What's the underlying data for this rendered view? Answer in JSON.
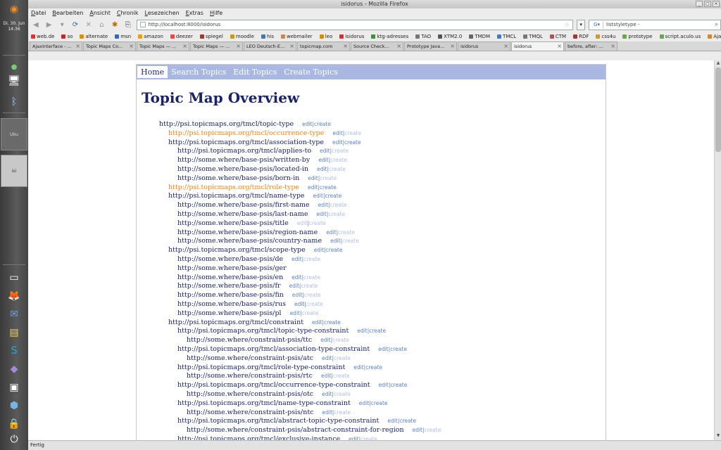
{
  "window": {
    "title": "isidorus - Mozilla Firefox"
  },
  "dock": {
    "clock": "Di, 30. Jun\n14:36",
    "task1": "Ubu",
    "task2": "isi"
  },
  "menubar": [
    "Datei",
    "Bearbeiten",
    "Ansicht",
    "Chronik",
    "Lesezeichen",
    "Extras",
    "Hilfe"
  ],
  "navbar": {
    "url": "http://localhost:8000/isidorus",
    "search_value": "liststyletype -",
    "search_engine_icon": "google-icon"
  },
  "bookmarks": [
    "web.de",
    "so",
    "alternate",
    "msn",
    "amazon",
    "deezer",
    "spiegel",
    "moodle",
    "his",
    "webmailer",
    "leo",
    "isidorus",
    "ktg-adresses",
    "TAO",
    "XTM2.0",
    "TMDM",
    "TMCL",
    "TMQL",
    "CTM",
    "RDF",
    "css4u",
    "prototype",
    "script.aculo.us",
    "Ajaxian"
  ],
  "tabs": [
    {
      "label": "AjaxInterface - ..."
    },
    {
      "label": "Topic Maps Co..."
    },
    {
      "label": "Topic Maps — ..."
    },
    {
      "label": "Topic Maps — ..."
    },
    {
      "label": "LEO Deutsch-E..."
    },
    {
      "label": "topicmap.com"
    },
    {
      "label": "Source Check..."
    },
    {
      "label": "Prototype Java..."
    },
    {
      "label": "isidorus"
    },
    {
      "label": "isidorus",
      "active": true
    },
    {
      "label": "before, after: ..."
    }
  ],
  "sitenav": {
    "home": "Home",
    "search": "Search Topics",
    "edit": "Edit Topics",
    "create": "Create Topics"
  },
  "page": {
    "heading": "Topic Map Overview",
    "edit": "edit",
    "create": "create"
  },
  "topics": [
    {
      "uri": "http://psi.topicmaps.org/tmcl/topic-type",
      "level": 0,
      "create_enabled": true
    },
    {
      "uri": "http://psi.topicmaps.org/tmcl/occurrence-type",
      "level": 1,
      "orange": true,
      "create_enabled": false
    },
    {
      "uri": "http://psi.topicmaps.org/tmcl/association-type",
      "level": 1,
      "create_enabled": true
    },
    {
      "uri": "http://psi.topicmaps.org/tmcl/applies-to",
      "level": 2,
      "create_enabled": false
    },
    {
      "uri": "http://some.where/base-psis/written-by",
      "level": 2,
      "create_enabled": false
    },
    {
      "uri": "http://some.where/base-psis/located-in",
      "level": 2,
      "create_enabled": false
    },
    {
      "uri": "http://some.where/base-psis/born-in",
      "level": 2,
      "create_enabled": false
    },
    {
      "uri": "http://psi.topicmaps.org/tmcl/role-type",
      "level": 1,
      "orange": true,
      "create_enabled": true
    },
    {
      "uri": "http://psi.topicmaps.org/tmcl/name-type",
      "level": 1,
      "create_enabled": true
    },
    {
      "uri": "http://some.where/base-psis/first-name",
      "level": 2,
      "create_enabled": false
    },
    {
      "uri": "http://some.where/base-psis/last-name",
      "level": 2,
      "create_enabled": false
    },
    {
      "uri": "http://some.where/base-psis/title",
      "level": 2,
      "create_enabled": false,
      "edit_dim": true
    },
    {
      "uri": "http://some.where/base-psis/region-name",
      "level": 2,
      "create_enabled": false
    },
    {
      "uri": "http://some.where/base-psis/country-name",
      "level": 2,
      "create_enabled": false
    },
    {
      "uri": "http://psi.topicmaps.org/tmcl/scope-type",
      "level": 1,
      "create_enabled": true
    },
    {
      "uri": "http://some.where/base-psis/de",
      "level": 2,
      "create_enabled": false
    },
    {
      "uri": "http://some.where/base-psis/ger",
      "level": 2,
      "hide_actions": true
    },
    {
      "uri": "http://some.where/base-psis/en",
      "level": 2,
      "create_enabled": false
    },
    {
      "uri": "http://some.where/base-psis/fr",
      "level": 2,
      "create_enabled": false
    },
    {
      "uri": "http://some.where/base-psis/fin",
      "level": 2,
      "create_enabled": false
    },
    {
      "uri": "http://some.where/base-psis/rus",
      "level": 2,
      "create_enabled": false
    },
    {
      "uri": "http://some.where/base-psis/pl",
      "level": 2,
      "create_enabled": false
    },
    {
      "uri": "http://psi.topicmaps.org/tmcl/constraint",
      "level": 1,
      "create_enabled": true
    },
    {
      "uri": "http://psi.topicmaps.org/tmcl/topic-type-constraint",
      "level": 2,
      "create_enabled": true
    },
    {
      "uri": "http://some.where/constraint-psis/ttc",
      "level": 3,
      "create_enabled": false
    },
    {
      "uri": "http://psi.topicmaps.org/tmcl/association-type-constraint",
      "level": 2,
      "create_enabled": true
    },
    {
      "uri": "http://some.where/constraint-psis/atc",
      "level": 3,
      "create_enabled": false
    },
    {
      "uri": "http://psi.topicmaps.org/tmcl/role-type-constraint",
      "level": 2,
      "create_enabled": true
    },
    {
      "uri": "http://some.where/constraint-psis/rtc",
      "level": 3,
      "create_enabled": false
    },
    {
      "uri": "http://psi.topicmaps.org/tmcl/occurrence-type-constraint",
      "level": 2,
      "create_enabled": true
    },
    {
      "uri": "http://some.where/constraint-psis/otc",
      "level": 3,
      "create_enabled": false
    },
    {
      "uri": "http://psi.topicmaps.org/tmcl/name-type-constraint",
      "level": 2,
      "create_enabled": true
    },
    {
      "uri": "http://some.where/constraint-psis/ntc",
      "level": 3,
      "create_enabled": false
    },
    {
      "uri": "http://psi.topicmaps.org/tmcl/abstract-topic-type-constraint",
      "level": 2,
      "create_enabled": true
    },
    {
      "uri": "http://some.where/constraint-psis/abstract-constraint-for-region",
      "level": 3,
      "create_enabled": false
    },
    {
      "uri": "http://psi.topicmaps.org/tmcl/exclusive-instance",
      "level": 2,
      "create_enabled": false
    }
  ],
  "status": "Fertig",
  "colors": {
    "nav_bg": "#aab7e0",
    "link": "#1c2266",
    "orange": "#e8861c",
    "action": "#5a7fc0"
  }
}
